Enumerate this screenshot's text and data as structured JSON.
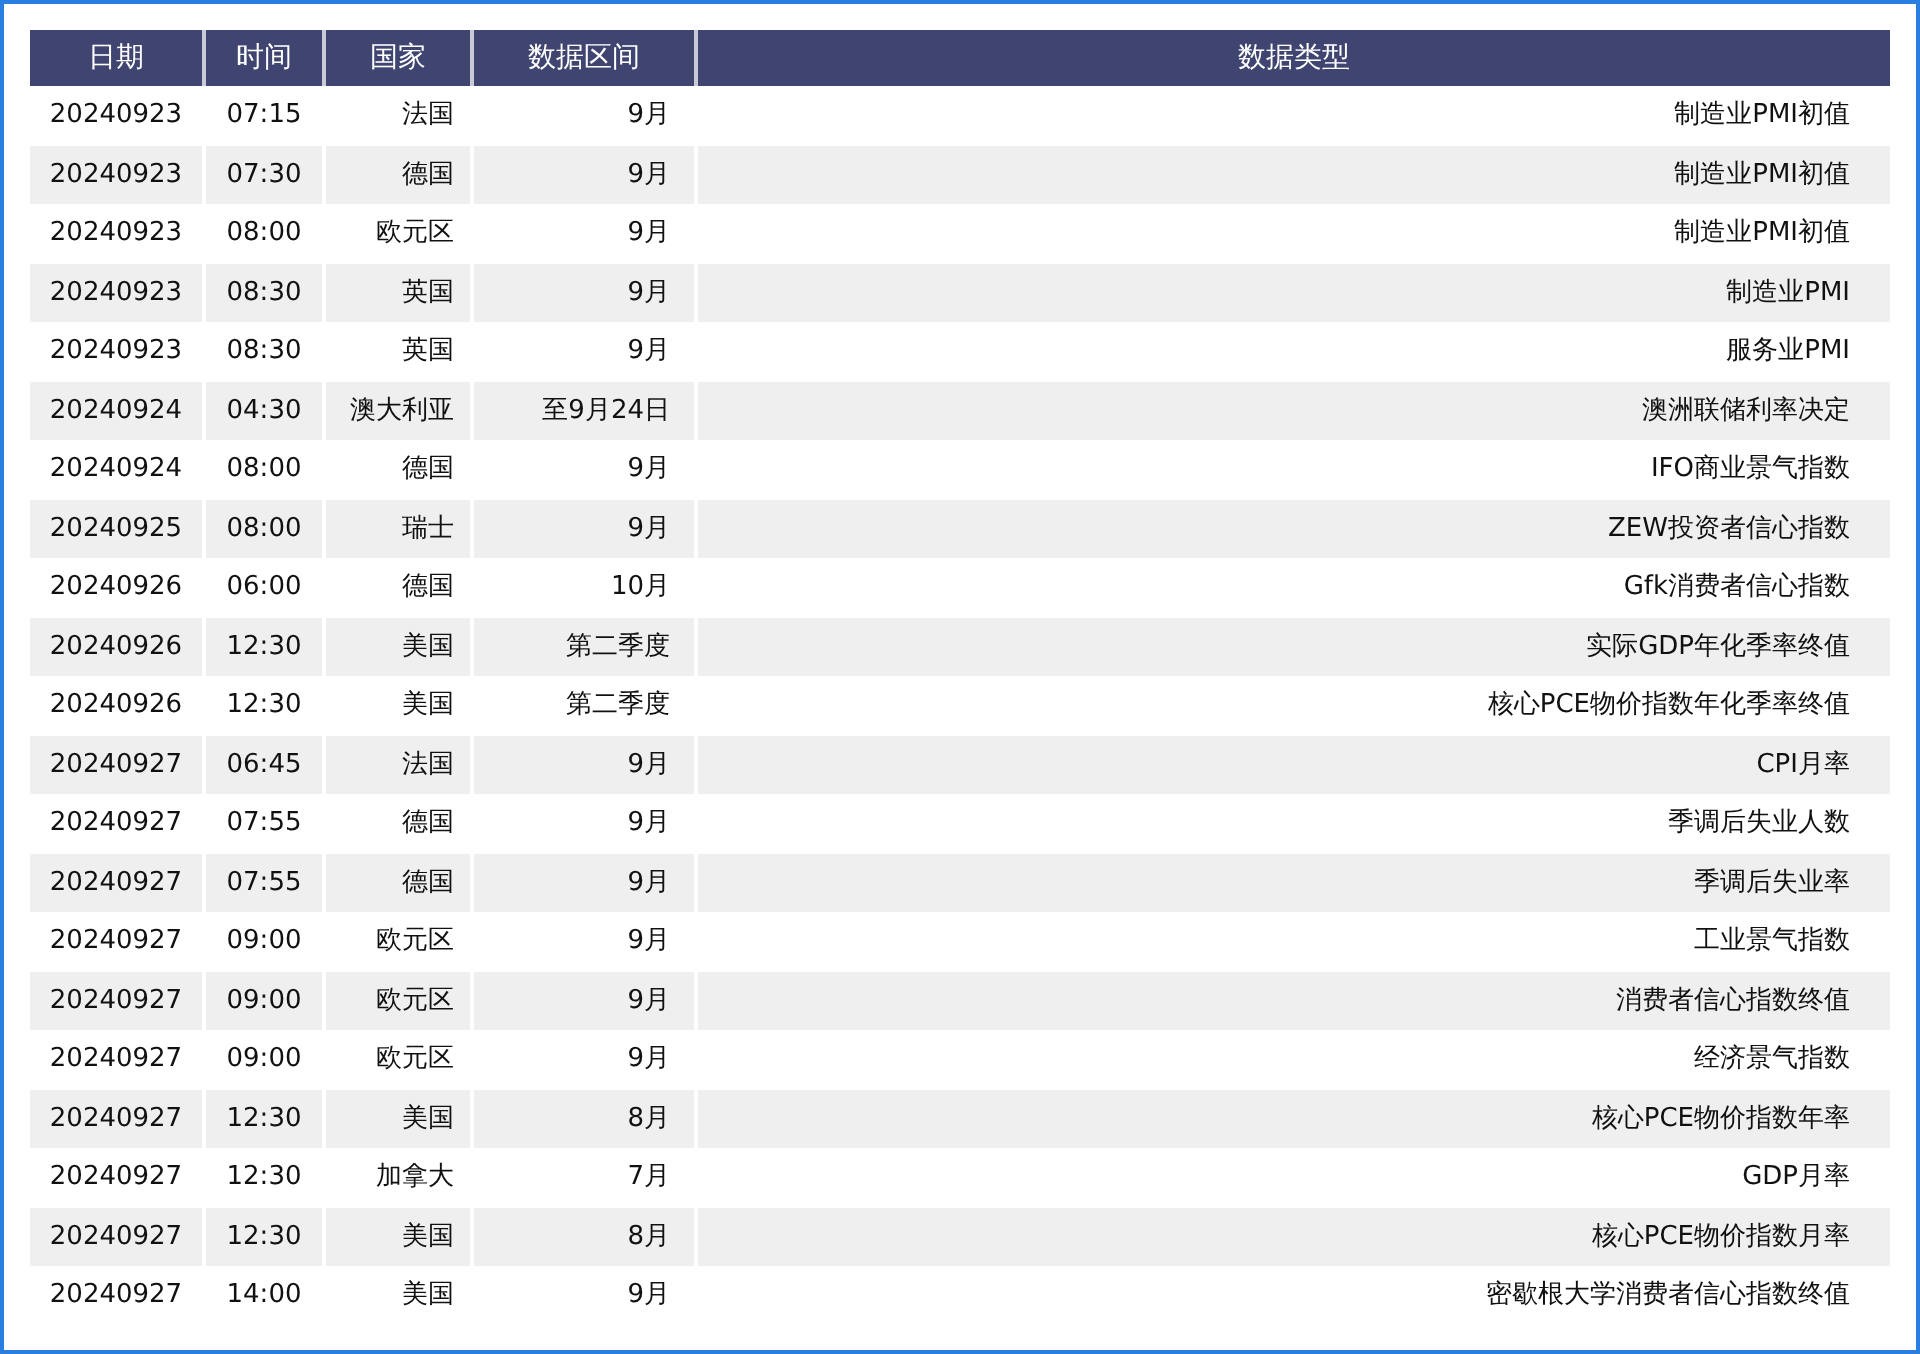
{
  "table": {
    "columns": [
      "日期",
      "时间",
      "国家",
      "数据区间",
      "数据类型"
    ],
    "rows": [
      [
        "20240923",
        "07:15",
        "法国",
        "9月",
        "制造业PMI初值"
      ],
      [
        "20240923",
        "07:30",
        "德国",
        "9月",
        "制造业PMI初值"
      ],
      [
        "20240923",
        "08:00",
        "欧元区",
        "9月",
        "制造业PMI初值"
      ],
      [
        "20240923",
        "08:30",
        "英国",
        "9月",
        "制造业PMI"
      ],
      [
        "20240923",
        "08:30",
        "英国",
        "9月",
        "服务业PMI"
      ],
      [
        "20240924",
        "04:30",
        "澳大利亚",
        "至9月24日",
        "澳洲联储利率决定"
      ],
      [
        "20240924",
        "08:00",
        "德国",
        "9月",
        "IFO商业景气指数"
      ],
      [
        "20240925",
        "08:00",
        "瑞士",
        "9月",
        "ZEW投资者信心指数"
      ],
      [
        "20240926",
        "06:00",
        "德国",
        "10月",
        "Gfk消费者信心指数"
      ],
      [
        "20240926",
        "12:30",
        "美国",
        "第二季度",
        "实际GDP年化季率终值"
      ],
      [
        "20240926",
        "12:30",
        "美国",
        "第二季度",
        "核心PCE物价指数年化季率终值"
      ],
      [
        "20240927",
        "06:45",
        "法国",
        "9月",
        "CPI月率"
      ],
      [
        "20240927",
        "07:55",
        "德国",
        "9月",
        "季调后失业人数"
      ],
      [
        "20240927",
        "07:55",
        "德国",
        "9月",
        "季调后失业率"
      ],
      [
        "20240927",
        "09:00",
        "欧元区",
        "9月",
        "工业景气指数"
      ],
      [
        "20240927",
        "09:00",
        "欧元区",
        "9月",
        "消费者信心指数终值"
      ],
      [
        "20240927",
        "09:00",
        "欧元区",
        "9月",
        "经济景气指数"
      ],
      [
        "20240927",
        "12:30",
        "美国",
        "8月",
        "核心PCE物价指数年率"
      ],
      [
        "20240927",
        "12:30",
        "加拿大",
        "7月",
        "GDP月率"
      ],
      [
        "20240927",
        "12:30",
        "美国",
        "8月",
        "核心PCE物价指数月率"
      ],
      [
        "20240927",
        "14:00",
        "美国",
        "9月",
        "密歇根大学消费者信心指数终值"
      ]
    ]
  }
}
